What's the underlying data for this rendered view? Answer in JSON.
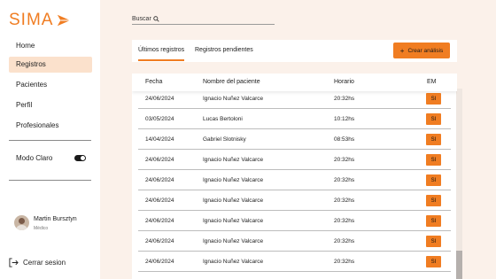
{
  "app": {
    "name": "SIMA",
    "accent": "#f07d22"
  },
  "sidebar": {
    "items": [
      {
        "label": "Home",
        "active": false
      },
      {
        "label": "Registros",
        "active": true
      },
      {
        "label": "Pacientes",
        "active": false
      },
      {
        "label": "Perfil",
        "active": false
      },
      {
        "label": "Profesionales",
        "active": false
      }
    ],
    "theme_toggle": {
      "label": "Modo Claro",
      "on": true
    },
    "user": {
      "name": "Martin Bursztyn",
      "role": "Médico"
    },
    "logout_label": "Cerrar sesion"
  },
  "search": {
    "label": "Buscar"
  },
  "tabs": [
    {
      "label": "Últimos registros",
      "active": true
    },
    {
      "label": "Registros pendientes",
      "active": false
    }
  ],
  "create_button": {
    "label": "Crear análisis"
  },
  "table": {
    "columns": [
      "Fecha",
      "Nombre del paciente",
      "Horario",
      "EM"
    ],
    "rows": [
      {
        "fecha": "24/06/2024",
        "nombre": "Ignacio Nuñez Valcarce",
        "horario": "20:32hs",
        "em": "SI"
      },
      {
        "fecha": "03/05/2024",
        "nombre": "Lucas Bertoloni",
        "horario": "10:12hs",
        "em": "SI"
      },
      {
        "fecha": "14/04/2024",
        "nombre": "Gabriel Slotnisky",
        "horario": "08:53hs",
        "em": "SI"
      },
      {
        "fecha": "24/06/2024",
        "nombre": "Ignacio Nuñez Valcarce",
        "horario": "20:32hs",
        "em": "SI"
      },
      {
        "fecha": "24/06/2024",
        "nombre": "Ignacio Nuñez Valcarce",
        "horario": "20:32hs",
        "em": "SI"
      },
      {
        "fecha": "24/06/2024",
        "nombre": "Ignacio Nuñez Valcarce",
        "horario": "20:32hs",
        "em": "SI"
      },
      {
        "fecha": "24/06/2024",
        "nombre": "Ignacio Nuñez Valcarce",
        "horario": "20:32hs",
        "em": "SI"
      },
      {
        "fecha": "24/06/2024",
        "nombre": "Ignacio Nuñez Valcarce",
        "horario": "20:32hs",
        "em": "SI"
      },
      {
        "fecha": "24/06/2024",
        "nombre": "Ignacio Nuñez Valcarce",
        "horario": "20:32hs",
        "em": "SI"
      }
    ]
  }
}
